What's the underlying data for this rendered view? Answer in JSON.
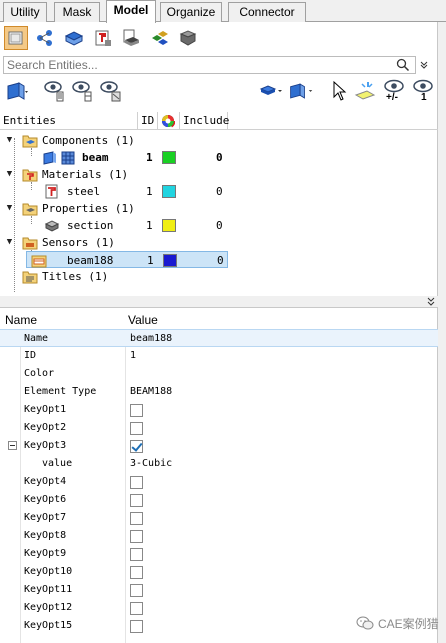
{
  "tabs": [
    {
      "label": "Utility",
      "active": false
    },
    {
      "label": "Mask",
      "active": false
    },
    {
      "label": "Model",
      "active": true
    },
    {
      "label": "Organize",
      "active": false
    },
    {
      "label": "Connector",
      "active": false
    }
  ],
  "entity_toolbar": {
    "icons": [
      "component-view-icon",
      "assembly-view-icon",
      "property-view-icon",
      "material-view-icon",
      "include-view-icon",
      "set-view-icon",
      "solver-view-icon"
    ]
  },
  "search": {
    "placeholder": "Search Entities..."
  },
  "view_toolbar": {
    "icons": [
      "filter-icon",
      "show-icon",
      "isolate-icon",
      "hide-icon",
      "display-icon",
      "color-icon",
      "pointer-icon",
      "highlight-icon",
      "show-hide-toggle-icon",
      "show-one-icon"
    ],
    "plus_minus_label": "+/-",
    "one_label": "1"
  },
  "tree": {
    "columns": {
      "entities": "Entities",
      "id": "ID",
      "include": "Include"
    },
    "rows": [
      {
        "label": "Components (1)",
        "kind": "folder"
      },
      {
        "label": "beam",
        "id": "1",
        "color": "#19d023",
        "include": "0",
        "bold": true
      },
      {
        "label": "Materials (1)",
        "kind": "folder"
      },
      {
        "label": "steel",
        "id": "1",
        "color": "#21d4e0",
        "include": "0"
      },
      {
        "label": "Properties (1)",
        "kind": "folder"
      },
      {
        "label": "section",
        "id": "1",
        "color": "#f0ee13",
        "include": "0"
      },
      {
        "label": "Sensors (1)",
        "kind": "folder"
      },
      {
        "label": "beam188",
        "id": "1",
        "color": "#1a1ad0",
        "include": "0",
        "selected": true
      },
      {
        "label": "Titles (1)",
        "kind": "folder"
      }
    ]
  },
  "properties": {
    "columns": {
      "name": "Name",
      "value": "Value"
    },
    "rows": [
      {
        "name": "Name",
        "value": "beam188"
      },
      {
        "name": "ID",
        "value": "1"
      },
      {
        "name": "Color",
        "value": ""
      },
      {
        "name": "Element Type",
        "value": "BEAM188"
      },
      {
        "name": "KeyOpt1",
        "checked": false
      },
      {
        "name": "KeyOpt2",
        "checked": false
      },
      {
        "name": "KeyOpt3",
        "checked": true
      },
      {
        "name": "value",
        "value": "3-Cubic"
      },
      {
        "name": "KeyOpt4",
        "checked": false
      },
      {
        "name": "KeyOpt6",
        "checked": false
      },
      {
        "name": "KeyOpt7",
        "checked": false
      },
      {
        "name": "KeyOpt8",
        "checked": false
      },
      {
        "name": "KeyOpt9",
        "checked": false
      },
      {
        "name": "KeyOpt10",
        "checked": false
      },
      {
        "name": "KeyOpt11",
        "checked": false
      },
      {
        "name": "KeyOpt12",
        "checked": false
      },
      {
        "name": "KeyOpt15",
        "checked": false
      }
    ]
  },
  "watermark": {
    "text": "CAE案例猎"
  },
  "colors": {
    "selection": "#cce4f7",
    "active_tool": "#f4c987"
  }
}
